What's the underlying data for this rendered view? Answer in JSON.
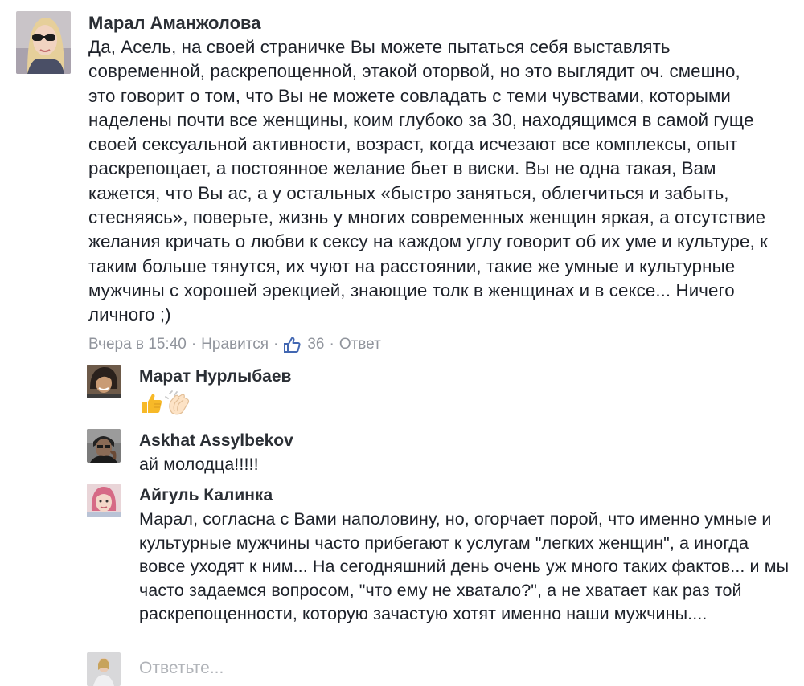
{
  "main_comment": {
    "author": "Марал Аманжолова",
    "text": "Да, Асель, на своей страничке Вы можете пытаться себя выставлять современной, раскрепощенной, этакой оторвой, но это выглядит оч. смешно, это говорит о том, что Вы не можете совладать с теми чувствами, которыми наделены почти все женщины, коим глубоко за 30, находящимся в самой гуще своей сексуальной активности, возраст, когда исчезают все комплексы, опыт раскрепощает, а постоянное желание бьет в виски. Вы не одна такая, Вам кажется, что Вы ас, а у остальных «быстро заняться, облегчиться и забыть, стесняясь», поверьте, жизнь у многих современных женщин яркая, а отсутствие желания кричать о любви к сексу на каждом углу говорит об их уме и культуре, к таким больше тянутся, их чуют на расстоянии, такие же умные и культурные мужчины с хорошей эрекцией, знающие толк в женщинах и в сексе... Ничего личного ;)",
    "timestamp": "Вчера в 15:40",
    "like_label": "Нравится",
    "like_count": "36",
    "reply_label": "Ответ",
    "separator": "·"
  },
  "replies": [
    {
      "author": "Марат Нурлыбаев",
      "emojis": [
        "thumbs-up-icon",
        "clapping-hands-icon"
      ]
    },
    {
      "author": "Askhat Assylbekov",
      "text": "ай молодца!!!!!"
    },
    {
      "author": "Айгуль Калинка",
      "text": "Марал, согласна с Вами наполовину, но, огорчает порой, что именно умные и культурные мужчины часто прибегают к услугам \"легких женщин\", а иногда вовсе уходят к ним... На сегодняшний день очень уж много таких фактов... и мы часто задаемся вопросом, \"что ему не хватало?\", а не хватает как раз той раскрепощенности, которую зачастую хотят именно наши мужчины...."
    }
  ],
  "reply_box": {
    "placeholder": "Ответьте..."
  },
  "colors": {
    "text": "#1d2129",
    "meta": "#90949c",
    "like_blue": "#4267b2",
    "emoji_yellow": "#f7b928"
  }
}
